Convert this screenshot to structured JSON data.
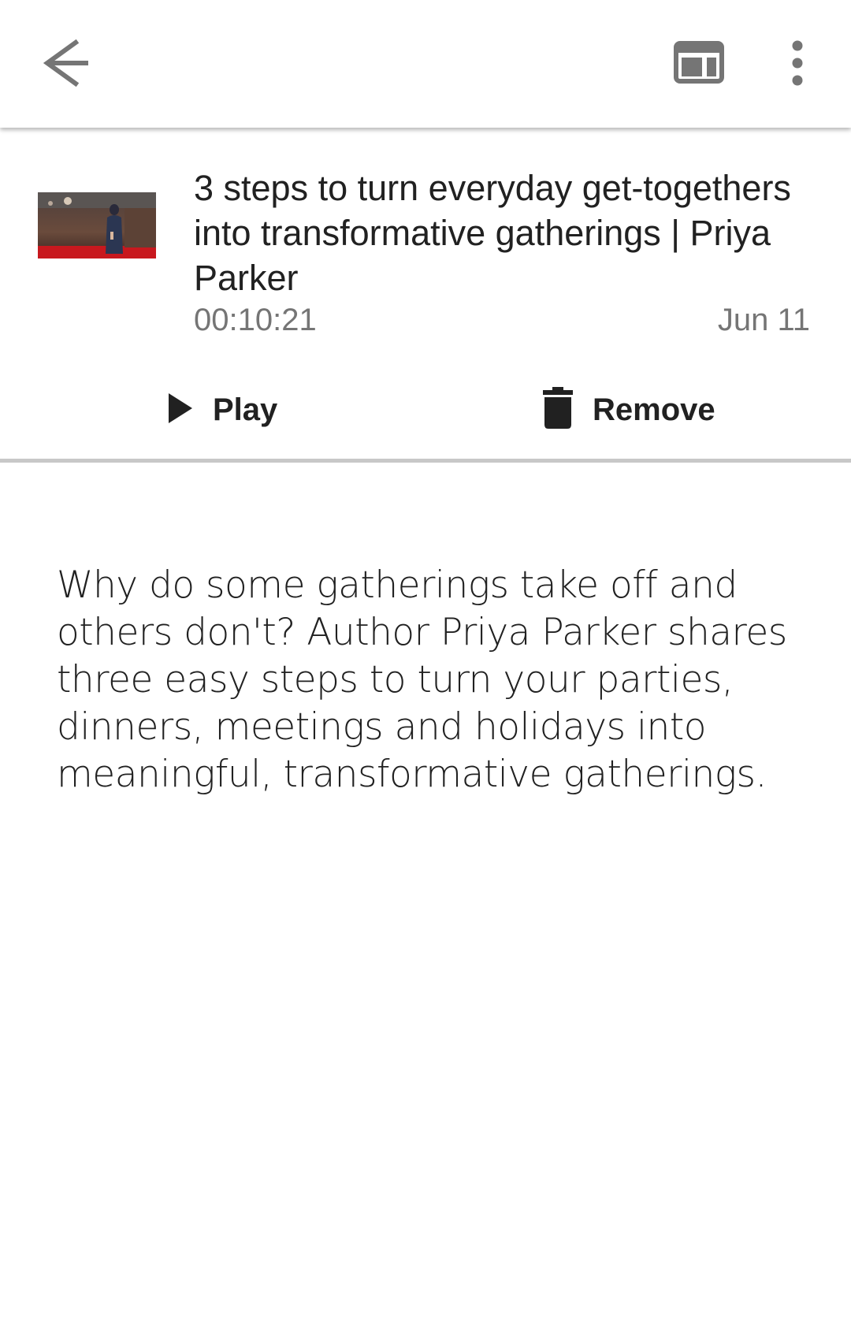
{
  "app_bar": {
    "back_icon": "arrow-back-icon",
    "layout_icon": "web-layout-icon",
    "more_icon": "more-vertical-icon"
  },
  "episode": {
    "thumbnail_icon": "talk-thumbnail",
    "title": "3 steps to turn everyday get-togethers into transformative gatherings | Priya Parker",
    "duration": "00:10:21",
    "date": "Jun 11",
    "actions": {
      "play_label": "Play",
      "play_icon": "play-icon",
      "remove_label": "Remove",
      "remove_icon": "trash-icon"
    }
  },
  "description": "Why do some gatherings take off and others don't? Author Priya Parker shares three easy steps to turn your parties, dinners, meetings and holidays into meaningful, transformative gatherings.",
  "colors": {
    "primary_text": "#212121",
    "secondary_text": "#757575",
    "icon": "#757575",
    "divider": "#c8c8c8",
    "background": "#ffffff"
  }
}
